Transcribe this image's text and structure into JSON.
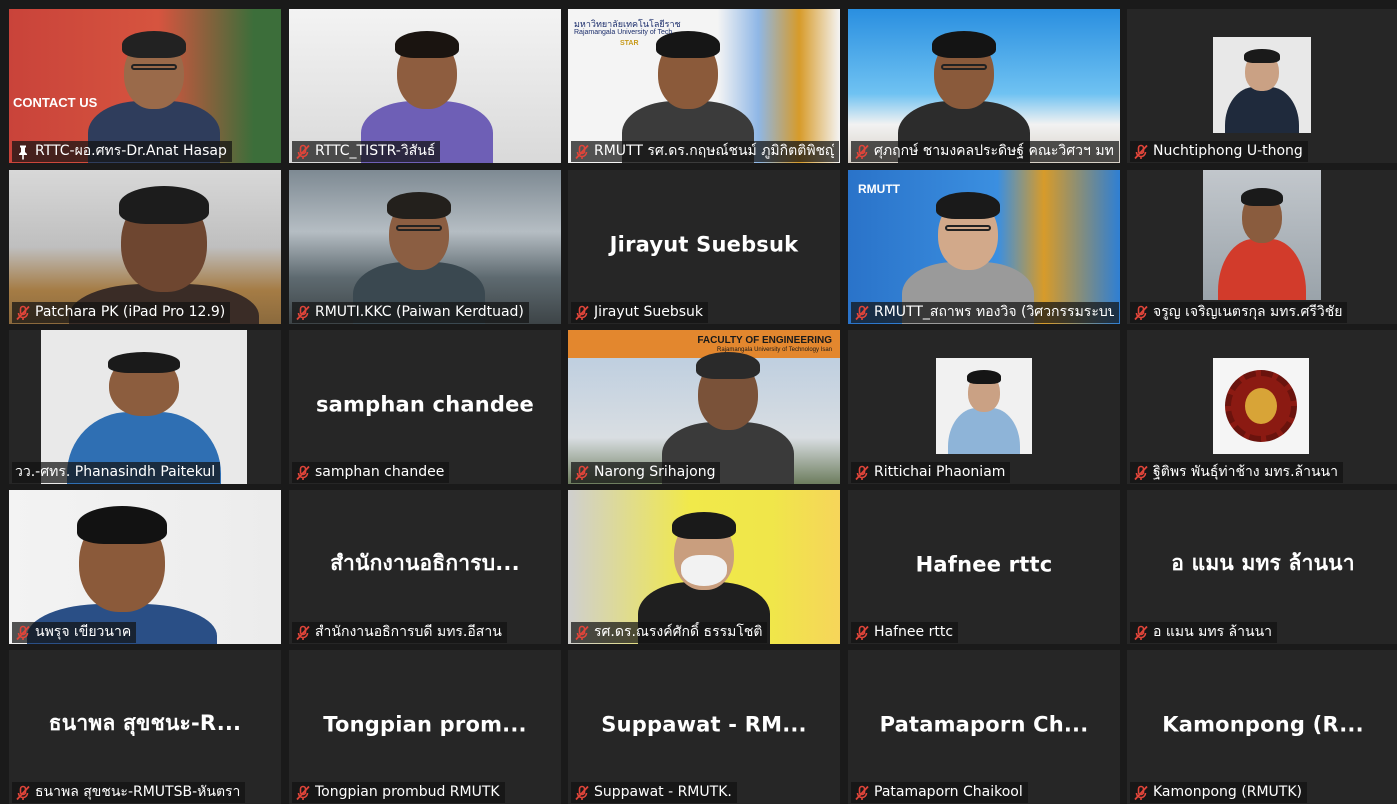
{
  "meeting": {
    "participants": [
      {
        "id": "p1",
        "label": "RTTC-ผอ.ศทร-Dr.Anat Hasap",
        "display": "",
        "pinned": true,
        "muted": false,
        "active": true
      },
      {
        "id": "p2",
        "label": "RTTC_TISTR-วิสันธ์",
        "display": "",
        "pinned": false,
        "muted": true,
        "active": false
      },
      {
        "id": "p3",
        "label": "RMUTT รศ.ดร.กฤษณ์ชนม์ ภูมิกิตติพิชญ์",
        "display": "",
        "pinned": false,
        "muted": true,
        "active": false,
        "overlay_text": [
          "มหาวิทยาลัยเทคโนโลยีราช",
          "Rajamangala University of Tech",
          "STAR"
        ]
      },
      {
        "id": "p4",
        "label": "ศุภฤกษ์ ชามงคลประดิษฐ์ คณะวิศวฯ มทร...",
        "display": "",
        "pinned": false,
        "muted": true,
        "active": false
      },
      {
        "id": "p5",
        "label": "Nuchtiphong U-thong",
        "display": "",
        "pinned": false,
        "muted": true,
        "active": false
      },
      {
        "id": "p6",
        "label": "Patchara PK  (iPad Pro 12.9)",
        "display": "",
        "pinned": false,
        "muted": true,
        "active": false
      },
      {
        "id": "p7",
        "label": "RMUTI.KKC (Paiwan Kerdtuad)",
        "display": "",
        "pinned": false,
        "muted": true,
        "active": false
      },
      {
        "id": "p8",
        "label": "Jirayut Suebsuk",
        "display": "Jirayut Suebsuk",
        "pinned": false,
        "muted": true,
        "active": false
      },
      {
        "id": "p9",
        "label": "RMUTT_สถาพร ทองวิจ (วิศวกรรมระบบ...",
        "display": "",
        "pinned": false,
        "muted": true,
        "active": false,
        "overlay_text": [
          "RMUTT"
        ]
      },
      {
        "id": "p10",
        "label": "จรูญ  เจริญเนตรกุล  มทร.ศรีวิชัย",
        "display": "",
        "pinned": false,
        "muted": true,
        "active": false
      },
      {
        "id": "p11",
        "label": "วว.-ศทร. Phanasindh Paitekul",
        "display": "",
        "pinned": false,
        "muted": false,
        "active": false
      },
      {
        "id": "p12",
        "label": "samphan chandee",
        "display": "samphan chandee",
        "pinned": false,
        "muted": true,
        "active": false
      },
      {
        "id": "p13",
        "label": "Narong Srihajong",
        "display": "",
        "pinned": false,
        "muted": true,
        "active": false,
        "overlay_text": [
          "FACULTY OF ENGINEERING",
          "Rajamangala University of Technology Isan"
        ]
      },
      {
        "id": "p14",
        "label": "Rittichai Phaoniam",
        "display": "",
        "pinned": false,
        "muted": true,
        "active": false
      },
      {
        "id": "p15",
        "label": "ฐิติพร พันธุ์ท่าช้าง มทร.ล้านนา",
        "display": "",
        "pinned": false,
        "muted": true,
        "active": false
      },
      {
        "id": "p16",
        "label": "นพรุจ เขียวนาค",
        "display": "",
        "pinned": false,
        "muted": true,
        "active": false
      },
      {
        "id": "p17",
        "label": "สำนักงานอธิการบดี มทร.อีสาน",
        "display": "สำนักงานอธิการบ...",
        "pinned": false,
        "muted": true,
        "active": false
      },
      {
        "id": "p18",
        "label": "รศ.ดร.ณรงค์ศักดิ์ ธรรมโชติ",
        "display": "",
        "pinned": false,
        "muted": true,
        "active": false
      },
      {
        "id": "p19",
        "label": "Hafnee rttc",
        "display": "Hafnee rttc",
        "pinned": false,
        "muted": true,
        "active": false
      },
      {
        "id": "p20",
        "label": "อ แมน มทร ล้านนา",
        "display": "อ แมน มทร ล้านนา",
        "pinned": false,
        "muted": true,
        "active": false
      },
      {
        "id": "p21",
        "label": "ธนาพล สุขชนะ-RMUTSB-หันตรา",
        "display": "ธนาพล สุขชนะ-R...",
        "pinned": false,
        "muted": true,
        "active": false
      },
      {
        "id": "p22",
        "label": "Tongpian prombud RMUTK",
        "display": "Tongpian  prom...",
        "pinned": false,
        "muted": true,
        "active": false
      },
      {
        "id": "p23",
        "label": "Suppawat - RMUTK.",
        "display": "Suppawat  -  RM...",
        "pinned": false,
        "muted": true,
        "active": false
      },
      {
        "id": "p24",
        "label": "Patamaporn Chaikool",
        "display": "Patamaporn  Ch...",
        "pinned": false,
        "muted": true,
        "active": false
      },
      {
        "id": "p25",
        "label": "Kamonpong (RMUTK)",
        "display": "Kamonpong  (R...",
        "pinned": false,
        "muted": true,
        "active": false
      }
    ],
    "p1_overlay_text": "CONTACT US",
    "colors": {
      "background": "#1a1a1a",
      "tile": "#262626",
      "active_border": "#9fd63a",
      "mute_icon": "#e0453a",
      "label_text": "#ffffff"
    },
    "icons": {
      "muted": "mic-muted-icon",
      "pinned": "pin-icon"
    }
  }
}
